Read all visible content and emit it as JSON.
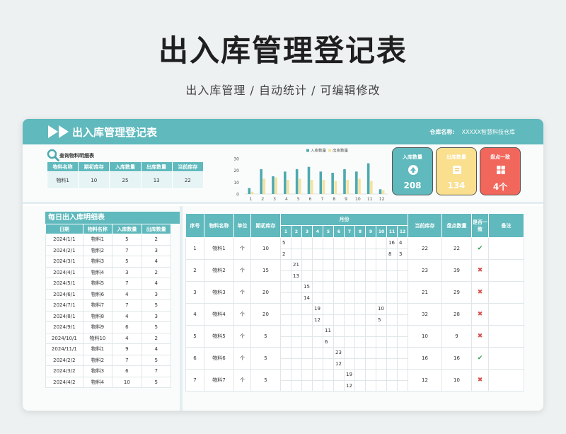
{
  "hero": {
    "title": "出入库管理登记表",
    "subtitle": "出入库管理  /  自动统计  /  可编辑修改"
  },
  "header": {
    "title": "出入库管理登记表",
    "warehouse_label": "仓库名称:",
    "warehouse_name": "XXXXX智慧科技仓库"
  },
  "query": {
    "label": "查询物料明细表",
    "columns": [
      "物料名称",
      "期初库存",
      "入库数量",
      "出库数量",
      "当前库存"
    ],
    "row": [
      "物料1",
      "10",
      "25",
      "13",
      "22"
    ]
  },
  "chart_data": {
    "type": "bar",
    "categories": [
      "1",
      "2",
      "3",
      "4",
      "5",
      "6",
      "7",
      "8",
      "9",
      "10",
      "11",
      "12"
    ],
    "series": [
      {
        "name": "入库数量",
        "values": [
          5,
          21,
          15,
          19,
          21,
          23,
          19,
          18,
          21,
          19,
          26,
          4
        ]
      },
      {
        "name": "出库数量",
        "values": [
          2,
          13,
          14,
          12,
          13,
          12,
          12,
          11,
          12,
          13,
          11,
          3
        ]
      }
    ],
    "ylim": [
      0,
      30
    ],
    "yticks": [
      0,
      10,
      20,
      30
    ],
    "legend": "top",
    "grid": false,
    "colors": [
      "#4ea9ae",
      "#f3e3a0"
    ]
  },
  "kpis": [
    {
      "label": "入库数量",
      "value": "208",
      "icon": "upload-icon",
      "color": "#5fb9bd"
    },
    {
      "label": "出库数量",
      "value": "134",
      "icon": "document-icon",
      "color": "#f9df8e"
    },
    {
      "label": "盘点一致",
      "value": "4个",
      "icon": "grid-icon",
      "color": "#f2675c"
    }
  ],
  "daily": {
    "title": "每日出入库明细表",
    "columns": [
      "日期",
      "物料名称",
      "入库数量",
      "出库数量"
    ],
    "rows": [
      [
        "2024/1/1",
        "物料1",
        "5",
        "2"
      ],
      [
        "2024/2/1",
        "物料2",
        "7",
        "3"
      ],
      [
        "2024/3/1",
        "物料3",
        "5",
        "4"
      ],
      [
        "2024/4/1",
        "物料4",
        "3",
        "2"
      ],
      [
        "2024/5/1",
        "物料5",
        "7",
        "4"
      ],
      [
        "2024/6/1",
        "物料6",
        "4",
        "3"
      ],
      [
        "2024/7/1",
        "物料7",
        "7",
        "5"
      ],
      [
        "2024/8/1",
        "物料8",
        "4",
        "3"
      ],
      [
        "2024/9/1",
        "物料9",
        "6",
        "5"
      ],
      [
        "2024/10/1",
        "物料10",
        "4",
        "2"
      ],
      [
        "2024/11/1",
        "物料1",
        "9",
        "4"
      ],
      [
        "2024/2/2",
        "物料2",
        "7",
        "5"
      ],
      [
        "2024/3/2",
        "物料3",
        "6",
        "7"
      ],
      [
        "2024/4/2",
        "物料4",
        "10",
        "5"
      ]
    ]
  },
  "main": {
    "columns": {
      "seq": "序号",
      "name": "物料名称",
      "unit": "单位",
      "opening": "期初库存",
      "month": "月份",
      "current": "当前库存",
      "counted": "盘点数量",
      "consistent": "是否一致",
      "remark": "备注"
    },
    "months": [
      "1",
      "2",
      "3",
      "4",
      "5",
      "6",
      "7",
      "8",
      "9",
      "10",
      "11",
      "12"
    ],
    "rows": [
      {
        "seq": "1",
        "name": "物料1",
        "unit": "个",
        "opening": "10",
        "in": [
          "5",
          "",
          "",
          "",
          "",
          "",
          "",
          "",
          "",
          "",
          "16",
          "4"
        ],
        "out": [
          "2",
          "",
          "",
          "",
          "",
          "",
          "",
          "",
          "",
          "",
          "8",
          "3"
        ],
        "current": "22",
        "counted": "22",
        "consistent": "✔",
        "status": "ok"
      },
      {
        "seq": "2",
        "name": "物料2",
        "unit": "个",
        "opening": "15",
        "in": [
          "",
          "21",
          "",
          "",
          "",
          "",
          "",
          "",
          "",
          "",
          "",
          ""
        ],
        "out": [
          "",
          "13",
          "",
          "",
          "",
          "",
          "",
          "",
          "",
          "",
          "",
          ""
        ],
        "current": "23",
        "counted": "39",
        "consistent": "✖",
        "status": "bad"
      },
      {
        "seq": "3",
        "name": "物料3",
        "unit": "个",
        "opening": "20",
        "in": [
          "",
          "",
          "15",
          "",
          "",
          "",
          "",
          "",
          "",
          "",
          "",
          ""
        ],
        "out": [
          "",
          "",
          "14",
          "",
          "",
          "",
          "",
          "",
          "",
          "",
          "",
          ""
        ],
        "current": "21",
        "counted": "29",
        "consistent": "✖",
        "status": "bad"
      },
      {
        "seq": "4",
        "name": "物料4",
        "unit": "个",
        "opening": "20",
        "in": [
          "",
          "",
          "",
          "19",
          "",
          "",
          "",
          "",
          "",
          "10",
          "",
          ""
        ],
        "out": [
          "",
          "",
          "",
          "12",
          "",
          "",
          "",
          "",
          "",
          "5",
          "",
          ""
        ],
        "current": "32",
        "counted": "28",
        "consistent": "✖",
        "status": "bad"
      },
      {
        "seq": "5",
        "name": "物料5",
        "unit": "个",
        "opening": "5",
        "in": [
          "",
          "",
          "",
          "",
          "11",
          "",
          "",
          "",
          "",
          "",
          "",
          ""
        ],
        "out": [
          "",
          "",
          "",
          "",
          "6",
          "",
          "",
          "",
          "",
          "",
          "",
          ""
        ],
        "current": "10",
        "counted": "9",
        "consistent": "✖",
        "status": "bad"
      },
      {
        "seq": "6",
        "name": "物料6",
        "unit": "个",
        "opening": "5",
        "in": [
          "",
          "",
          "",
          "",
          "",
          "23",
          "",
          "",
          "",
          "",
          "",
          ""
        ],
        "out": [
          "",
          "",
          "",
          "",
          "",
          "12",
          "",
          "",
          "",
          "",
          "",
          ""
        ],
        "current": "16",
        "counted": "16",
        "consistent": "✔",
        "status": "ok"
      },
      {
        "seq": "7",
        "name": "物料7",
        "unit": "个",
        "opening": "5",
        "in": [
          "",
          "",
          "",
          "",
          "",
          "",
          "19",
          "",
          "",
          "",
          "",
          ""
        ],
        "out": [
          "",
          "",
          "",
          "",
          "",
          "",
          "12",
          "",
          "",
          "",
          "",
          ""
        ],
        "current": "12",
        "counted": "10",
        "consistent": "✖",
        "status": "bad"
      }
    ]
  }
}
